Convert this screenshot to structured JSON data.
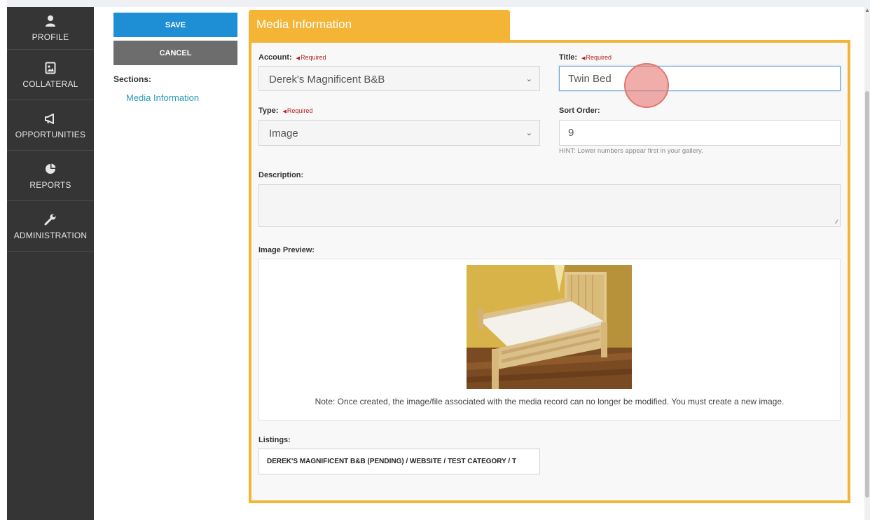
{
  "sidebar": {
    "items": [
      {
        "label": "PROFILE",
        "icon": "user-icon"
      },
      {
        "label": "COLLATERAL",
        "icon": "image-file-icon"
      },
      {
        "label": "OPPORTUNITIES",
        "icon": "megaphone-icon"
      },
      {
        "label": "REPORTS",
        "icon": "pie-chart-icon"
      },
      {
        "label": "ADMINISTRATION",
        "icon": "wrench-icon"
      }
    ]
  },
  "actions": {
    "save_label": "SAVE",
    "cancel_label": "CANCEL"
  },
  "sections": {
    "title": "Sections:",
    "link": "Media Information"
  },
  "form": {
    "tab_title": "Media Information",
    "required_text": "Required",
    "account": {
      "label": "Account:",
      "value": "Derek's Magnificent B&B"
    },
    "title": {
      "label": "Title:",
      "value": "Twin Bed"
    },
    "type": {
      "label": "Type:",
      "value": "Image"
    },
    "sort_order": {
      "label": "Sort Order:",
      "value": "9",
      "hint": "HINT: Lower numbers appear first in your gallery."
    },
    "description": {
      "label": "Description:",
      "value": ""
    },
    "image_preview": {
      "label": "Image Preview:",
      "note": "Note: Once created, the image/file associated with the media record can no longer be modified. You must create a new image."
    },
    "listings": {
      "label": "Listings:",
      "value": "DEREK'S MAGNIFICENT B&B (PENDING) / WEBSITE / TEST CATEGORY / T"
    }
  },
  "colors": {
    "accent": "#f4b435",
    "save": "#1e8fd5",
    "cancel": "#6d6d6d",
    "sidebar": "#353535",
    "link": "#2a9bb5",
    "required": "#b22222"
  }
}
